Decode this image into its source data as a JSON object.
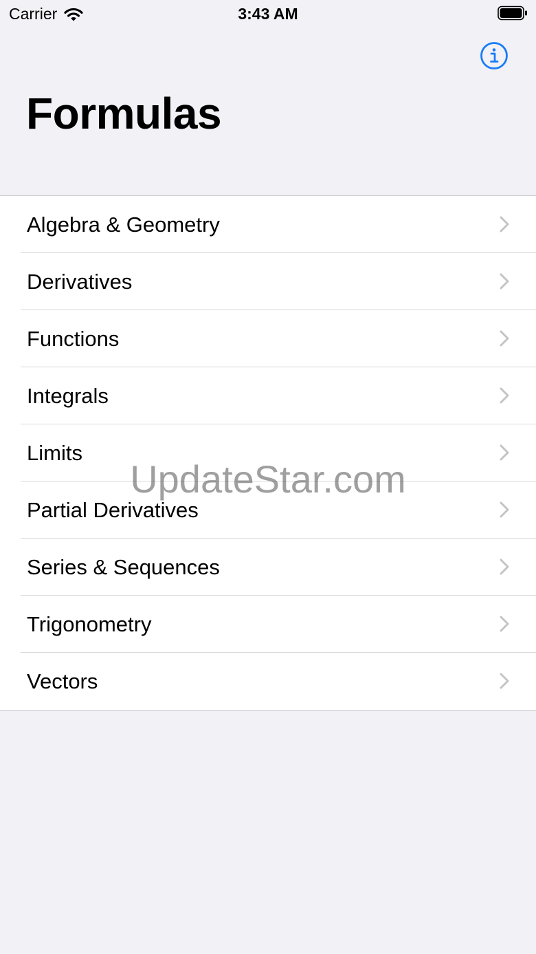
{
  "status_bar": {
    "carrier": "Carrier",
    "time": "3:43 AM"
  },
  "nav": {
    "title": "Formulas",
    "info_icon": "info-circle-icon",
    "accent_color": "#1a7cf5"
  },
  "categories": [
    {
      "label": "Algebra & Geometry"
    },
    {
      "label": "Derivatives"
    },
    {
      "label": "Functions"
    },
    {
      "label": "Integrals"
    },
    {
      "label": "Limits"
    },
    {
      "label": "Partial Derivatives"
    },
    {
      "label": "Series & Sequences"
    },
    {
      "label": "Trigonometry"
    },
    {
      "label": "Vectors"
    }
  ],
  "watermark": "UpdateStar.com"
}
